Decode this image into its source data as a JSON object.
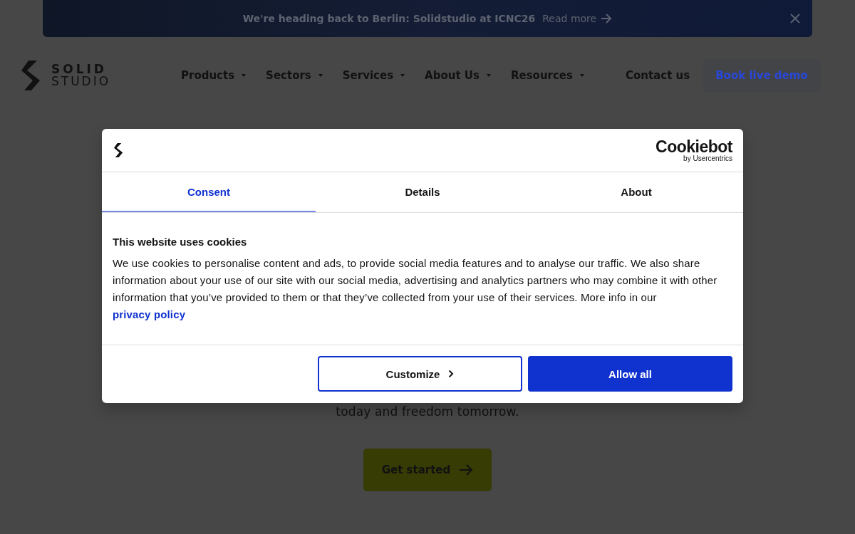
{
  "banner": {
    "text": "We're heading back to Berlin: Solidstudio at ICNC26",
    "link": "Read more"
  },
  "header": {
    "logo": [
      "SOLID",
      "STUDIO"
    ],
    "nav": [
      {
        "label": "Products",
        "dropdown": true
      },
      {
        "label": "Sectors",
        "dropdown": true
      },
      {
        "label": "Services",
        "dropdown": true
      },
      {
        "label": "About Us",
        "dropdown": true
      },
      {
        "label": "Resources",
        "dropdown": true
      },
      {
        "label": "Contact us",
        "dropdown": false
      }
    ],
    "cta": "Book live demo"
  },
  "hero": {
    "subtitle": "today and freedom tomorrow.",
    "button": "Get started"
  },
  "dialog": {
    "brand": {
      "name": "Cookiebot",
      "byline": "by Usercentrics"
    },
    "tabs": [
      {
        "label": "Consent",
        "selected": true
      },
      {
        "label": "Details",
        "selected": false
      },
      {
        "label": "About",
        "selected": false
      }
    ],
    "title": "This website uses cookies",
    "body": "We use cookies to personalise content and ads, to provide social media features and to analyse our traffic. We also share information about your use of our site with our social media, advertising and analytics partners who may combine it with other information that you’ve provided to them or that they’ve collected from your use of their services. More info in our",
    "link": "privacy policy",
    "buttons": [
      {
        "label": "Customize",
        "kind": "secondary"
      },
      {
        "label": "Allow all",
        "kind": "primary"
      }
    ]
  }
}
